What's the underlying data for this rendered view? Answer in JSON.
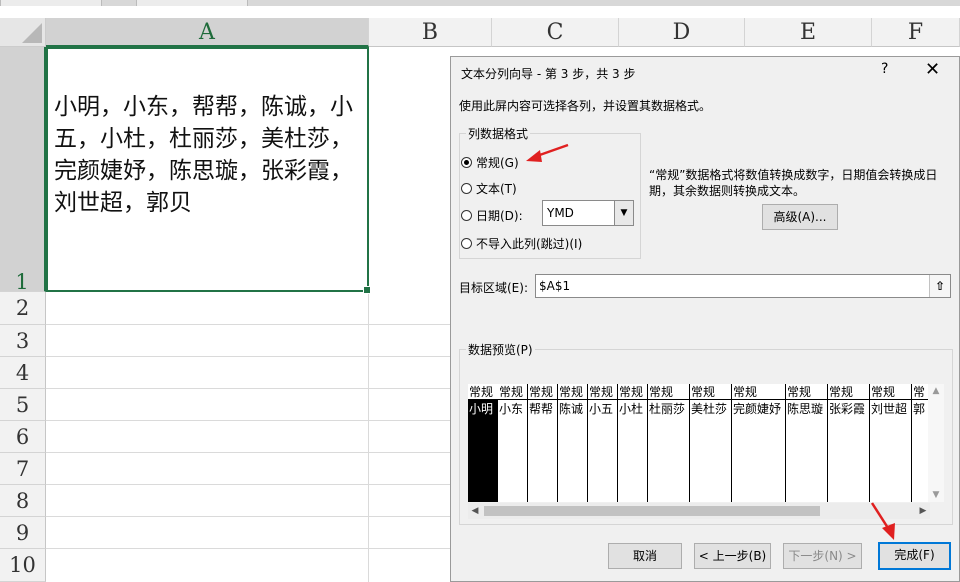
{
  "grid": {
    "columns": [
      "A",
      "B",
      "C",
      "D",
      "E",
      "F"
    ],
    "rows": [
      "1",
      "2",
      "3",
      "4",
      "5",
      "6",
      "7",
      "8",
      "9",
      "10"
    ],
    "a1_text": "小明，小东，帮帮，陈诚，小五，小杜，杜丽莎，美杜莎，完颜婕妤，陈思璇，张彩霞，刘世超，郭贝"
  },
  "dialog": {
    "title": "文本分列向导 - 第 3 步，共 3 步",
    "help": "?",
    "close": "✕",
    "description": "使用此屏内容可选择各列，并设置其数据格式。",
    "format_group_label": "列数据格式",
    "radios": {
      "general": "常规(G)",
      "text": "文本(T)",
      "date": "日期(D):",
      "skip": "不导入此列(跳过)(I)"
    },
    "date_format": "YMD",
    "info_text": "“常规”数据格式将数值转换成数字，日期值会转换成日期，其余数据则转换成文本。",
    "advanced_button": "高级(A)...",
    "target_label": "目标区域(E):",
    "target_value": "$A$1",
    "preview_label": "数据预览(P)",
    "preview_headers": [
      "常规",
      "常规",
      "常规",
      "常规",
      "常规",
      "常规",
      "常规",
      "常规",
      "常规",
      "常规",
      "常规",
      "常规",
      "常"
    ],
    "preview_values": [
      "小明",
      "小东",
      "帮帮",
      "陈诚",
      "小五",
      "小杜",
      "杜丽莎",
      "美杜莎",
      "完颜婕妤",
      "陈思璇",
      "张彩霞",
      "刘世超",
      "郭"
    ],
    "buttons": {
      "cancel": "取消",
      "back": "< 上一步(B)",
      "next": "下一步(N) >",
      "finish": "完成(F)"
    }
  },
  "colors": {
    "selection_green": "#217346",
    "annotation_red": "#e02020"
  }
}
